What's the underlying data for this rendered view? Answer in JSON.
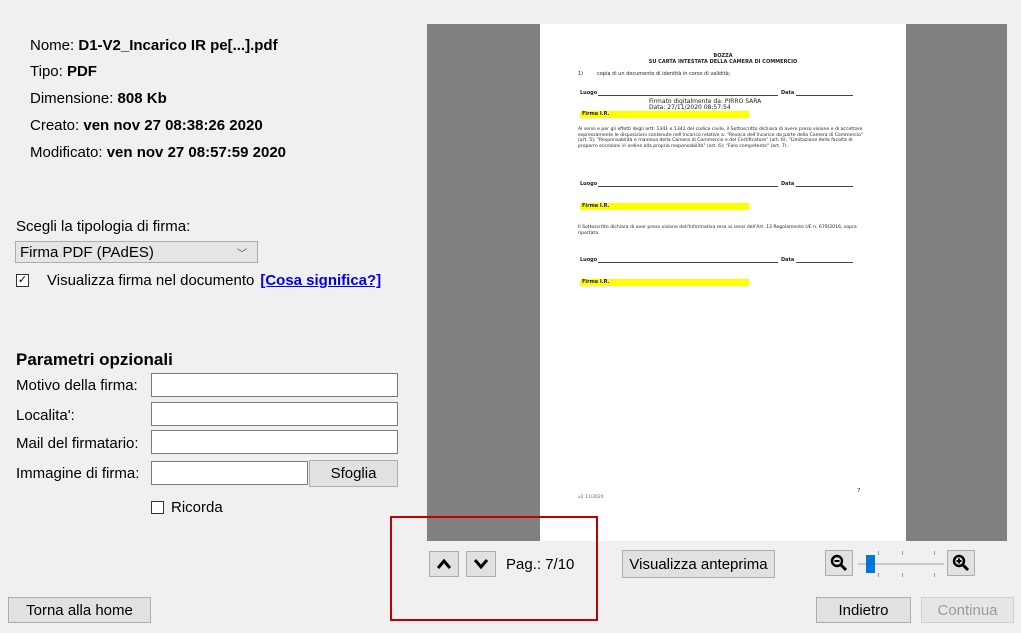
{
  "file_info": {
    "name_label": "Nome:",
    "name_value": "D1-V2_Incarico IR pe[...].pdf",
    "type_label": "Tipo:",
    "type_value": "PDF",
    "size_label": "Dimensione:",
    "size_value": "808 Kb",
    "created_label": "Creato:",
    "created_value": "ven nov 27 08:38:26 2020",
    "modified_label": "Modificato:",
    "modified_value": "ven nov 27 08:57:59 2020"
  },
  "signature": {
    "type_label": "Scegli la tipologia di firma:",
    "type_selected": "Firma PDF (PAdES)",
    "show_checkbox_label": "Visualizza firma nel documento",
    "show_checked": true,
    "check_mark": "✓",
    "help_link": "[Cosa significa?]"
  },
  "optional": {
    "title": "Parametri opzionali",
    "reason_label": "Motivo della firma:",
    "reason_value": "",
    "location_label": "Localita':",
    "location_value": "",
    "email_label": "Mail del firmatario:",
    "email_value": "",
    "image_label": "Immagine di firma:",
    "image_value": "",
    "browse_button": "Sfoglia",
    "remember_label": "Ricorda",
    "remember_checked": false
  },
  "document": {
    "heading1": "BOZZA",
    "heading2": "SU CARTA INTESTATA DELLA CAMERA DI COMMERCIO",
    "item1_num": "1)",
    "item1_text": "copia di un documento di identità in corso di validità;",
    "luogo": "Luogo",
    "data": "Data",
    "stamp_line1": "Firmato digitalmente da: PIRRO SARA",
    "stamp_line2": "Data: 27/11/2020 08:57:54",
    "firma": "Firma I.R.",
    "para1": "Ai sensi e per gli effetti degli artt. 1341 e 1342 del codice civile, il Sottoscritto dichiara di avere preso visione e di accettare espressamente le disposizioni contenute nell'incarico relative a: \"Revoca dell'incarico da parte della Camera di Commercio\" (art. 5); \"Responsabilità e manleva della Camera di Commercio e del Certificatore\" (art. 6); \"Limitazione della facoltà di proporre eccezioni in ordine alla propria responsabilità\" (art. 6); \"Foro competente\" (art. 7).",
    "para2": "Il Sottoscritto dichiara di aver preso visione dell'Informativa resa ai sensi dell'Art. 13 Regolamento UE n. 679/2016, sopra riportata.",
    "footer_left": "v2 11/2020",
    "page_number": "7"
  },
  "navigation": {
    "page_label": "Pag.: 7/10",
    "preview_button": "Visualizza anteprima",
    "zoom_level": 0.1,
    "up_icon": "chevron-up-icon",
    "down_icon": "chevron-down-icon",
    "zoom_out_icon": "zoom-out-icon",
    "zoom_in_icon": "zoom-in-icon"
  },
  "footer": {
    "home_button": "Torna alla home",
    "back_button": "Indietro",
    "continue_button": "Continua"
  },
  "colors": {
    "highlight": "#ffff00",
    "annotation": "#c00000",
    "link": "#0000ee",
    "viewer_bg": "#808080"
  }
}
